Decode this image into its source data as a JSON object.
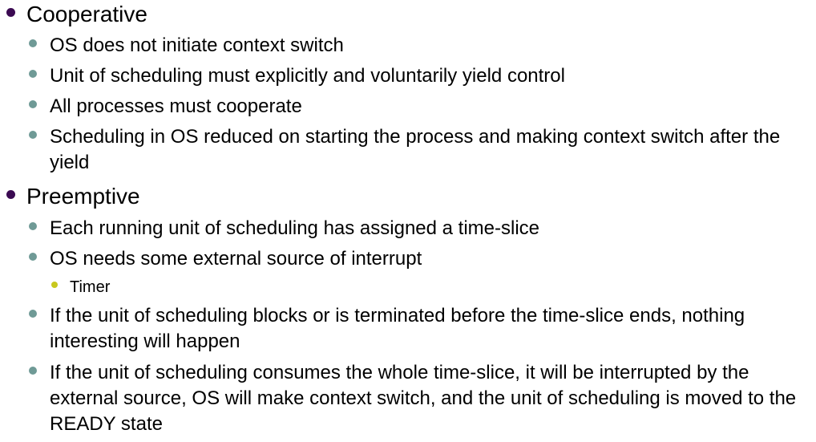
{
  "colors": {
    "level1_bullet": "#3b0a52",
    "level2_bullet": "#6f9a96",
    "level3_bullet": "#c8c81e"
  },
  "items": [
    {
      "level": 1,
      "text": "Cooperative"
    },
    {
      "level": 2,
      "text": "OS does not initiate context switch"
    },
    {
      "level": 2,
      "text": "Unit of scheduling must explicitly and voluntarily yield control"
    },
    {
      "level": 2,
      "text": "All processes must cooperate"
    },
    {
      "level": 2,
      "text": "Scheduling in OS reduced on starting the process and making context switch after the yield"
    },
    {
      "level": 1,
      "text": "Preemptive"
    },
    {
      "level": 2,
      "text": "Each running unit of scheduling has assigned a time-slice"
    },
    {
      "level": 2,
      "text": "OS needs some external source of interrupt"
    },
    {
      "level": 3,
      "text": "Timer"
    },
    {
      "level": 2,
      "text": "If the unit of scheduling blocks or is terminated before the time-slice ends, nothing interesting will happen"
    },
    {
      "level": 2,
      "text": "If the unit of scheduling consumes the whole time-slice, it will be interrupted by the external source, OS will make context switch, and the unit of scheduling is moved to the READY state"
    }
  ]
}
